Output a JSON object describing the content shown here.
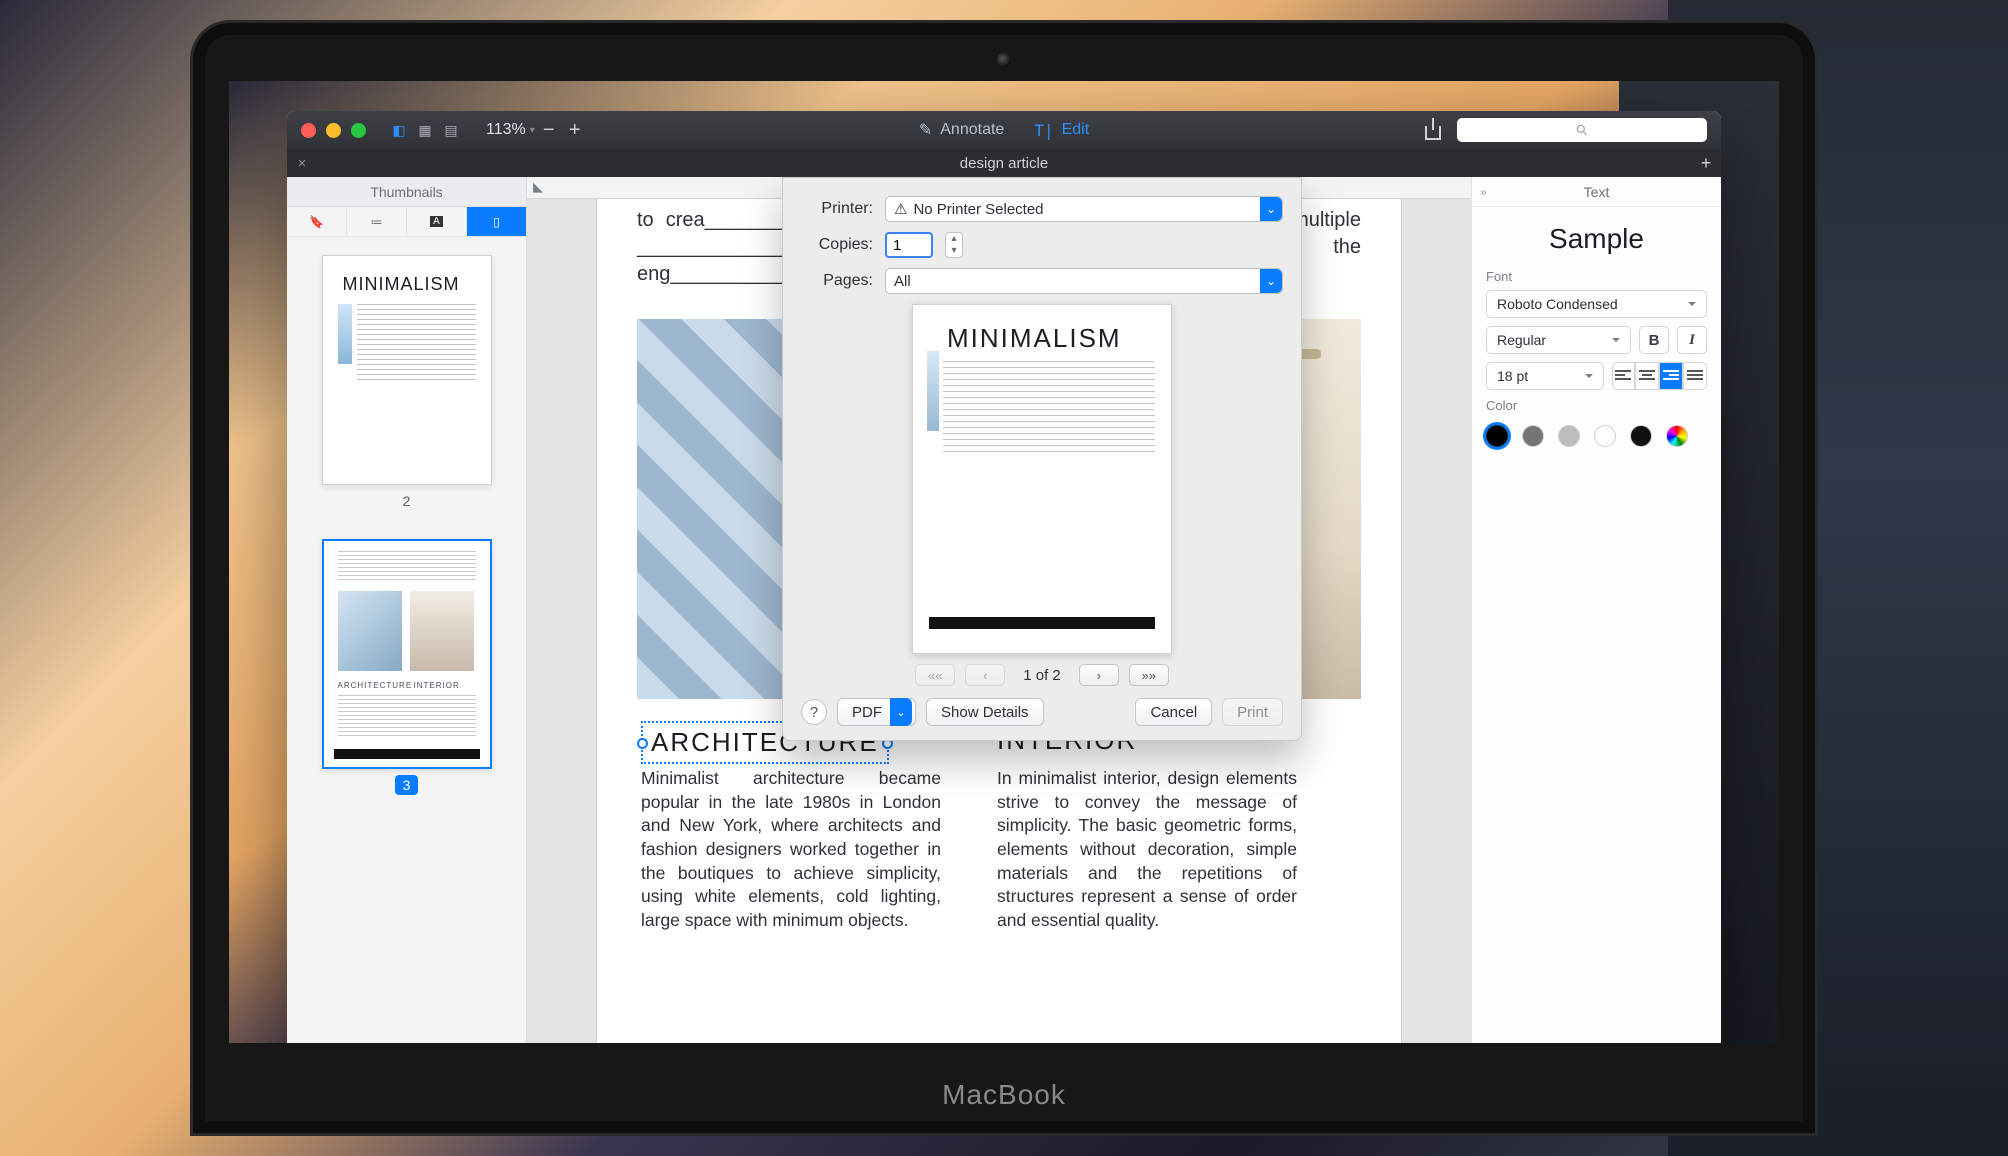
{
  "laptop_brand": "MacBook",
  "toolbar": {
    "zoom": "113%",
    "annotate": "Annotate",
    "edit": "Edit"
  },
  "search": {
    "placeholder": ""
  },
  "tab": {
    "title": "design article"
  },
  "thumbnails": {
    "title": "Thumbnails",
    "page2_heading": "MINIMALISM",
    "page2_num": "2",
    "page3_h1": "ARCHITECTURE",
    "page3_h2": "INTERIOR",
    "page3_num": "3"
  },
  "document": {
    "top_text": "to crea_______________________________ ___ _______ _o serve multiple ________________________________________ _dopted the eng_________________________________________echnol-ogy anc",
    "heading_left": "ARCHITECTURE",
    "heading_right": "INTERIOR",
    "col_left": "Minimalist architecture became popular in the late 1980s in London and New York, where architects and fashion designers worked together in the boutiques to achieve simplicity, using white elements, cold lighting, large space with minimum objects.",
    "col_right": "In minimalist interior, design elements strive to convey the message of simplicity. The basic geometric forms, elements without decoration, simple materials and the repetitions of structures represent a sense of order and essential quality."
  },
  "print": {
    "printer_label": "Printer:",
    "printer_value": "No Printer Selected",
    "copies_label": "Copies:",
    "copies_value": "1",
    "pages_label": "Pages:",
    "pages_value": "All",
    "preview_heading": "MINIMALISM",
    "page_indicator": "1 of 2",
    "pdf": "PDF",
    "show_details": "Show Details",
    "cancel": "Cancel",
    "print_btn": "Print",
    "help": "?"
  },
  "inspector": {
    "title": "Text",
    "sample": "Sample",
    "font_label": "Font",
    "font_family": "Roboto Condensed",
    "font_style": "Regular",
    "font_size": "18 pt",
    "bold": "B",
    "italic": "I",
    "color_label": "Color",
    "colors": [
      "#000000",
      "#757575",
      "#bdbdbd",
      "#ffffff",
      "#111111",
      "rainbow"
    ]
  }
}
